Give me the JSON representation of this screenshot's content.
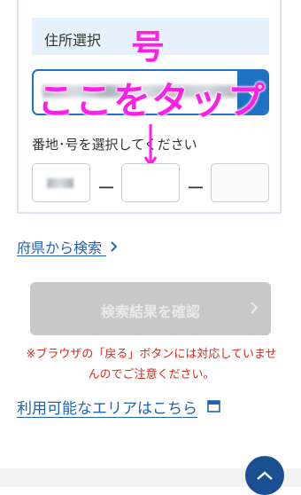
{
  "form": {
    "section_title": "住所選択",
    "address_value": "",
    "sub_label": "番地･号を選択してください",
    "dash": "ー"
  },
  "annotations": {
    "top": "号",
    "middle": "ここをタップ"
  },
  "links": {
    "prefecture_search": "府県から検索",
    "available_area": "利用可能なエリアはこちら"
  },
  "confirm_button": {
    "label": "検索結果を確認"
  },
  "warning": {
    "line1": "※ブラウザの「戻る」ボタンには対応していませ",
    "line2": "んのでご注意ください。"
  },
  "colors": {
    "accent": "#1e72c4",
    "link": "#1e63b8",
    "warning": "#d12c1f",
    "annotation": "#ff1fe8",
    "disabled_button": "#c8c8c8",
    "page_top_button": "#1a4f91"
  },
  "icons": [
    "chevron-down-icon",
    "chevron-right-icon",
    "down-arrow-icon",
    "new-window-icon",
    "chevron-up-icon"
  ]
}
